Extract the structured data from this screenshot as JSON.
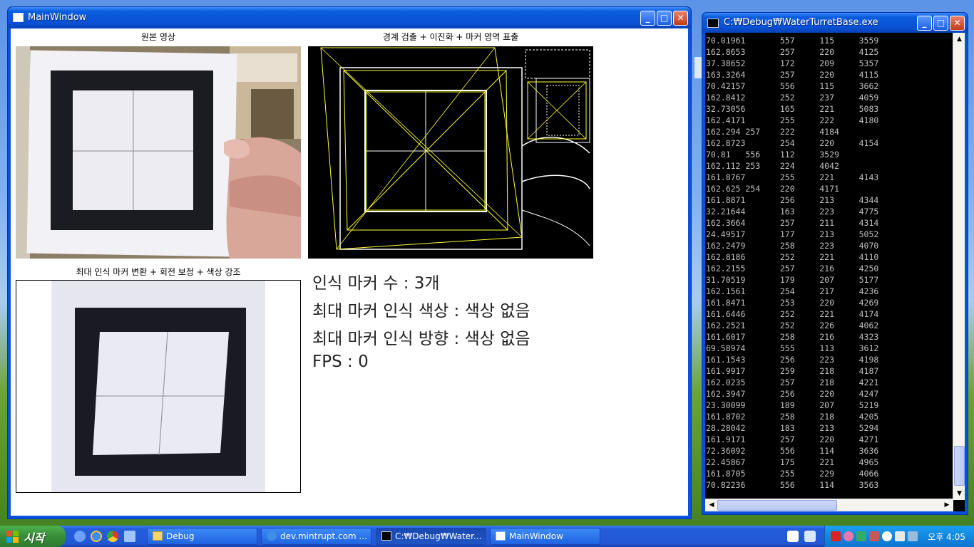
{
  "main_window": {
    "title": "MainWindow",
    "buttons": {
      "minimize": "_",
      "maximize": "□",
      "close": "✕"
    },
    "panels": {
      "source_label": "원본 영상",
      "edge_label": "경계 검출 + 이진화 + 마커 영역 표출",
      "warp_label": "최대 인식 마커 변환 + 회전 보정 + 색상 강조"
    },
    "info": {
      "marker_count": "인식 마커 수 : 3개",
      "marker_color": "최대 마커 인식 색상 : 색상 없음",
      "marker_direction": "최대 마커 인식 방향 : 색상 없음",
      "fps": "FPS : 0"
    }
  },
  "console_window": {
    "title": "C:₩Debug₩WaterTurretBase.exe",
    "buttons": {
      "minimize": "_",
      "maximize": "□",
      "close": "✕"
    },
    "lines": [
      "70.01961       557     115     3559",
      "162.8653       257     220     4125",
      "37.38652       172     209     5357",
      "163.3264       257     220     4115",
      "70.42157       556     115     3662",
      "162.8412       252     237     4059",
      "32.73056       165     221     5083",
      "162.4171       255     222     4180",
      "162.294 257    222     4184",
      "162.8723       254     220     4154",
      "70.81   556    112     3529",
      "162.112 253    224     4042",
      "161.8767       255     221     4143",
      "162.625 254    220     4171",
      "161.8871       256     213     4344",
      "32.21644       163     223     4775",
      "162.3664       257     211     4314",
      "24.49517       177     213     5052",
      "162.2479       258     223     4070",
      "162.8186       252     221     4110",
      "162.2155       257     216     4250",
      "31.70519       179     207     5177",
      "162.1561       254     217     4236",
      "161.8471       253     220     4269",
      "161.6446       252     221     4174",
      "162.2521       252     226     4062",
      "161.6017       258     216     4323",
      "69.58974       555     113     3612",
      "161.1543       256     223     4198",
      "161.9917       259     218     4187",
      "162.0235       257     218     4221",
      "162.3947       256     220     4247",
      "23.30099       189     207     5219",
      "161.8702       258     218     4205",
      "28.28042       183     213     5294",
      "161.9171       257     220     4271",
      "72.36092       556     114     3636",
      "22.45867       175     221     4965",
      "161.8705       255     229     4066",
      "70.82236       556     114     3563"
    ]
  },
  "taskbar": {
    "start_label": "시작",
    "tasks": [
      {
        "label": "Debug",
        "icon": "folder-icon"
      },
      {
        "label": "dev.mintrupt.com ...",
        "icon": "ie-icon"
      },
      {
        "label": "C:₩Debug₩Water...",
        "icon": "console-icon"
      },
      {
        "label": "MainWindow",
        "icon": "window-icon"
      }
    ],
    "clock": "오후 4:05"
  },
  "colors": {
    "xp_blue": "#0a52de",
    "marker_outline": "#ffff33",
    "console_text": "#c0c0c0"
  }
}
